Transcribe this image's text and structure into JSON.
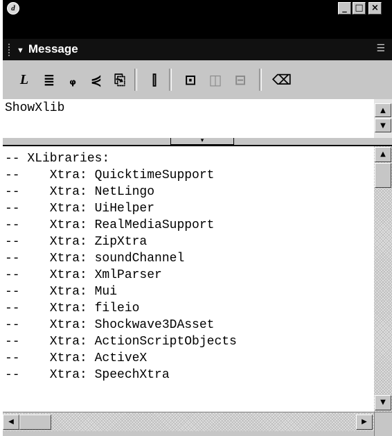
{
  "window": {
    "app_icon_glyph": "d",
    "buttons": {
      "minimize": "_",
      "maximize": "□",
      "close": "×"
    }
  },
  "panel": {
    "title": "Message",
    "collapse_glyph": "▼",
    "menu_glyph": "☰"
  },
  "toolbar": {
    "icons": [
      {
        "name": "lingo-menu-icon",
        "glyph": "L"
      },
      {
        "name": "alphabetical-lingo-icon",
        "glyph": "≣"
      },
      {
        "name": "categorized-lingo-icon",
        "glyph": "ᵩ"
      },
      {
        "name": "scripting-xtras-icon",
        "glyph": "⋞"
      },
      {
        "name": "trace-icon",
        "glyph": "⎘"
      },
      {
        "name": "go-to-handler-icon",
        "glyph": "⫿"
      },
      {
        "name": "debug-icon",
        "glyph": "⊡"
      },
      {
        "name": "watch-icon",
        "glyph": "◫"
      },
      {
        "name": "inspect-icon",
        "glyph": "⊟"
      },
      {
        "name": "clear-icon",
        "glyph": "⌫"
      }
    ]
  },
  "message_input": {
    "value": "ShowXlib"
  },
  "splitter_glyph": "▾",
  "output": {
    "lines": [
      "-- XLibraries:",
      "--    Xtra: QuicktimeSupport",
      "--    Xtra: NetLingo",
      "--    Xtra: UiHelper",
      "--    Xtra: RealMediaSupport",
      "--    Xtra: ZipXtra",
      "--    Xtra: soundChannel",
      "--    Xtra: XmlParser",
      "--    Xtra: Mui",
      "--    Xtra: fileio",
      "--    Xtra: Shockwave3DAsset",
      "--    Xtra: ActionScriptObjects",
      "--    Xtra: ActiveX",
      "--    Xtra: SpeechXtra"
    ]
  },
  "scroll": {
    "up": "▲",
    "down": "▼",
    "left": "◀",
    "right": "▶"
  }
}
